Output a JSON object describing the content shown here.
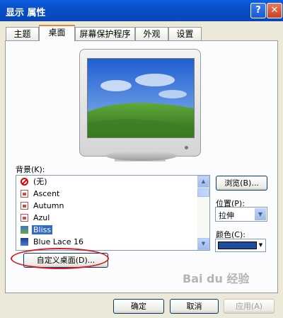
{
  "window": {
    "title": "显示 属性"
  },
  "titlebar": {
    "help_label": "?",
    "close_label": "✕"
  },
  "tabs": [
    {
      "label": "主题",
      "active": false
    },
    {
      "label": "桌面",
      "active": true
    },
    {
      "label": "屏幕保护程序",
      "active": false
    },
    {
      "label": "外观",
      "active": false
    },
    {
      "label": "设置",
      "active": false
    }
  ],
  "desktop": {
    "background_label": "背景(K):",
    "background_items": [
      {
        "label": "(无)",
        "icon": "none-icon",
        "selected": false
      },
      {
        "label": "Ascent",
        "icon": "image-file-icon",
        "selected": false
      },
      {
        "label": "Autumn",
        "icon": "image-file-icon",
        "selected": false
      },
      {
        "label": "Azul",
        "icon": "image-file-icon",
        "selected": false
      },
      {
        "label": "Bliss",
        "icon": "bliss-image-icon",
        "selected": true
      },
      {
        "label": "Blue Lace 16",
        "icon": "blue-lace-icon",
        "selected": false
      }
    ],
    "browse_label": "浏览(B)...",
    "position_label": "位置(P):",
    "position_value": "拉伸",
    "color_label": "颜色(C):",
    "color_value": "#1d4f9f",
    "customize_label": "自定义桌面(D)..."
  },
  "footer": {
    "ok_label": "确定",
    "cancel_label": "取消",
    "apply_label": "应用(A)"
  },
  "watermark": {
    "text": "Bai du 经验"
  },
  "colors": {
    "titlebar": "#0a4fc7",
    "selection": "#316ac5",
    "highlight_ellipse": "#d11f24"
  }
}
